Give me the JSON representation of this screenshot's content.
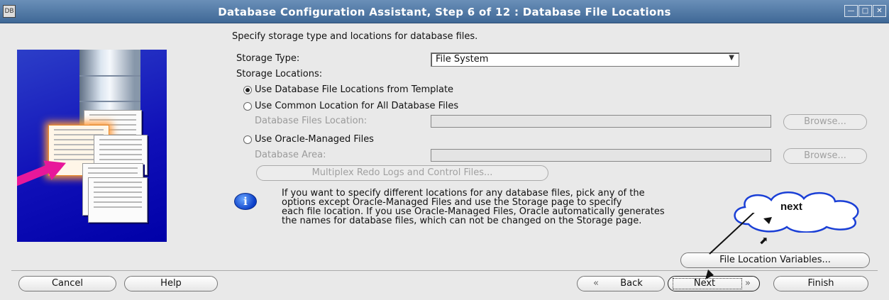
{
  "window": {
    "title": "Database Configuration Assistant, Step 6 of 12 : Database File Locations",
    "sys_icon": "DB",
    "controls": [
      "minimize-icon",
      "maximize-icon",
      "close-icon"
    ]
  },
  "main": {
    "heading": "Specify storage type and locations for database files.",
    "storage_type_label": "Storage Type:",
    "storage_type_value": "File System",
    "storage_locations_label": "Storage Locations:",
    "radio_template": "Use Database File Locations from Template",
    "radio_common": "Use Common Location for All Database Files",
    "db_files_location_label": "Database Files Location:",
    "db_files_location_value": "",
    "radio_omf": "Use Oracle-Managed Files",
    "db_area_label": "Database Area:",
    "db_area_value": "",
    "browse_label": "Browse...",
    "multiplex_label": "Multiplex Redo Logs and Control Files...",
    "info_text": "If you want to specify different locations for any database files, pick any of the\noptions except Oracle-Managed Files and use the Storage page to specify\neach file location. If you use Oracle-Managed Files, Oracle automatically generates\nthe names for database files, which can not be changed on the Storage page.",
    "file_location_variables_label": "File Location Variables..."
  },
  "footer": {
    "cancel": "Cancel",
    "help": "Help",
    "back": "Back",
    "next": "Next",
    "finish": "Finish"
  },
  "annotation": {
    "callout_text": "next"
  }
}
